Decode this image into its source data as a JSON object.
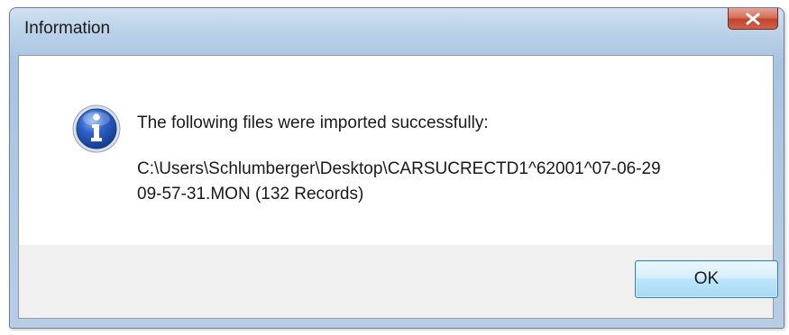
{
  "window": {
    "title": "Information"
  },
  "title_bar": {
    "close_icon": "close-icon"
  },
  "dialog": {
    "icon": "information-icon",
    "message_line_1": "The following files were imported successfully:",
    "message_line_2": "C:\\Users\\Schlumberger\\Desktop\\CARSUCRECTD1^62001^07-06-29",
    "message_line_3": "09-57-31.MON (132 Records)"
  },
  "buttons": {
    "ok_label": "OK"
  },
  "colors": {
    "title_bar": "#b9d0e8",
    "close_button": "#c2442c",
    "content_background": "#ffffff",
    "footer_background": "#f0f0f0",
    "ok_button_border": "#3c7fb1"
  }
}
